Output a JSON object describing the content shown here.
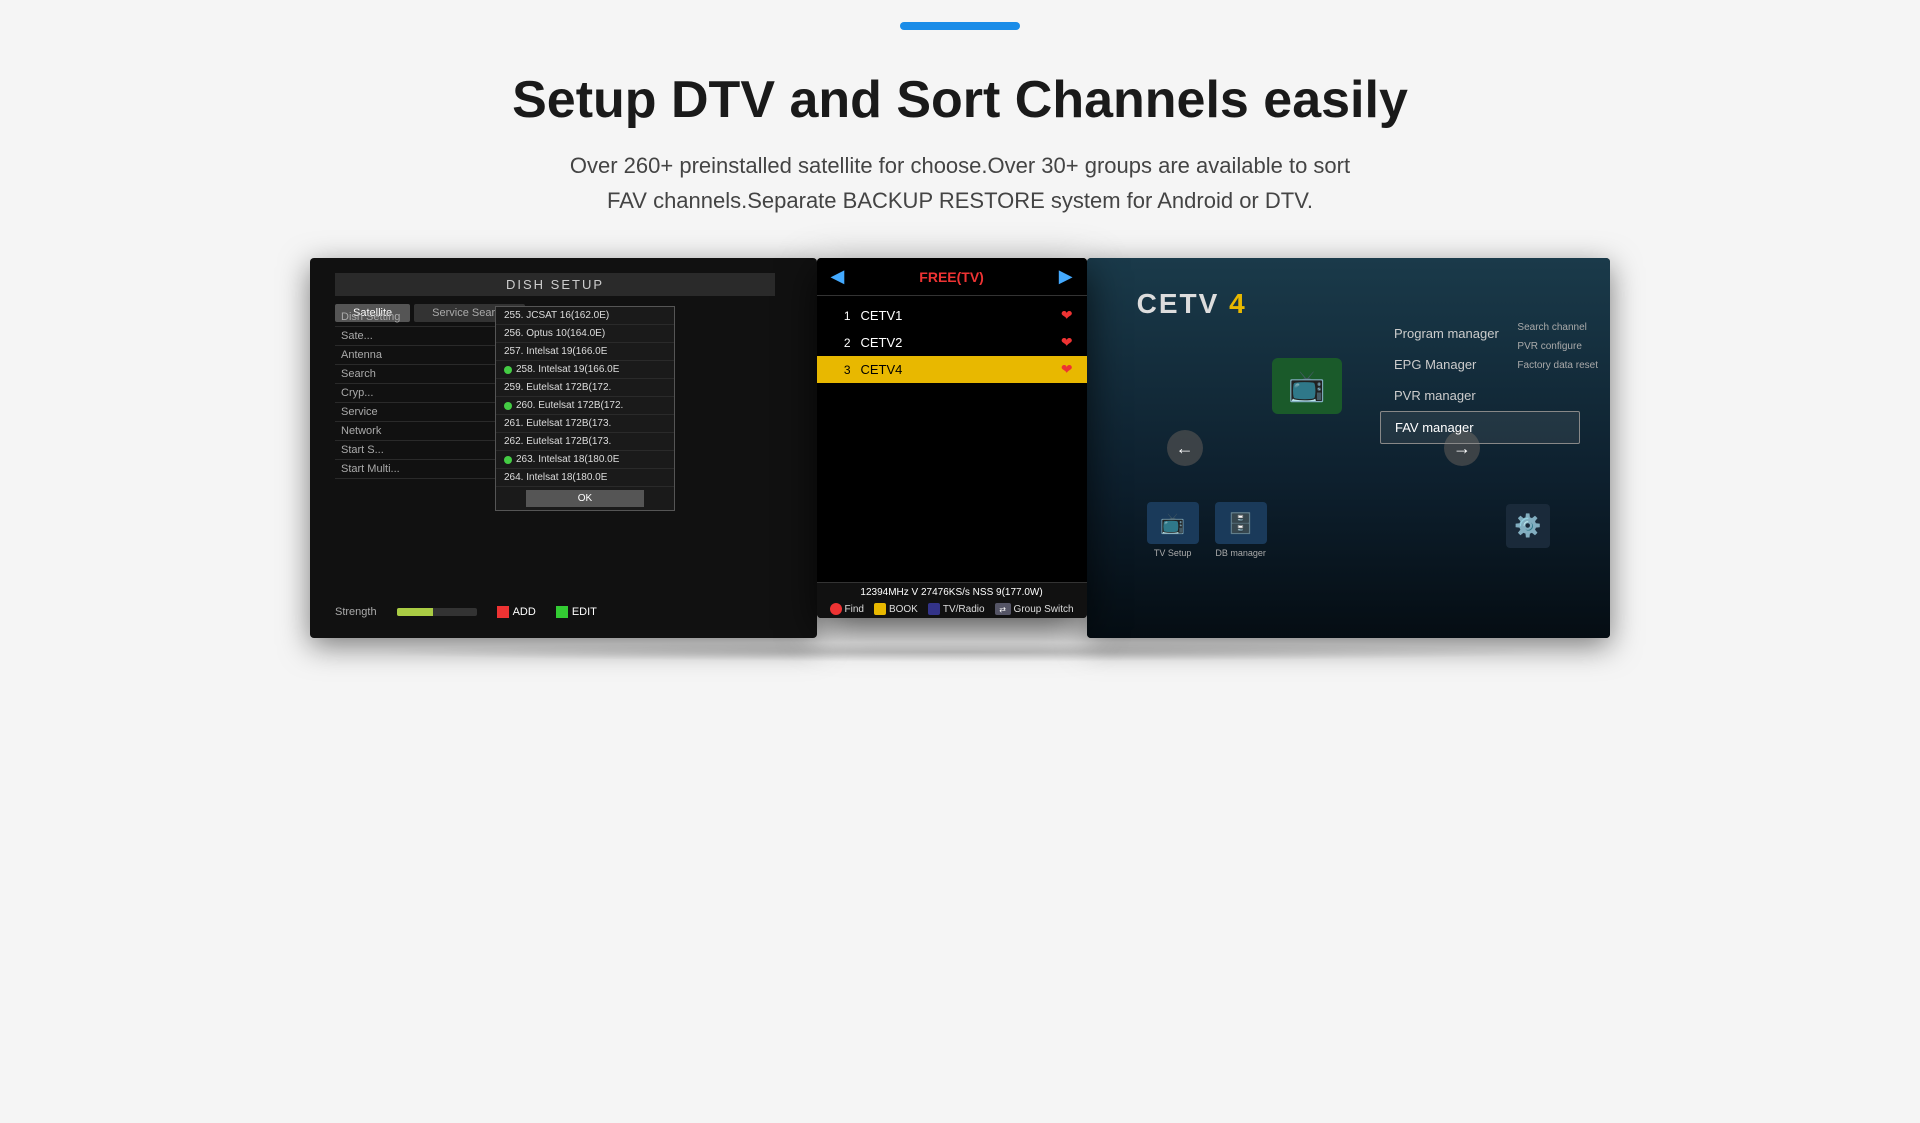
{
  "topbar": {
    "color": "#1a8ce8"
  },
  "header": {
    "title": "Setup DTV and Sort Channels easily",
    "subtitle_line1": "Over 260+ preinstalled satellite for choose.Over 30+ groups are available to sort",
    "subtitle_line2": "FAV channels.Separate BACKUP RESTORE system for Android or DTV."
  },
  "dish_setup": {
    "title": "DISH SETUP",
    "tab1": "Satellite",
    "tab2": "Service Search",
    "settings": [
      {
        "label": "Dish Setting",
        "value": ""
      },
      {
        "label": "Sate...",
        "value": ""
      },
      {
        "label": "Antenna",
        "value": ""
      },
      {
        "label": "Search",
        "value": ""
      },
      {
        "label": "Cryp...",
        "value": ""
      },
      {
        "label": "Service",
        "value": ""
      },
      {
        "label": "Network",
        "value": ""
      },
      {
        "label": "Start S...",
        "value": ""
      },
      {
        "label": "Start Multi...",
        "value": ""
      }
    ],
    "satellites": [
      {
        "num": "255.",
        "name": "JCSAT 16(162.0E)",
        "check": false
      },
      {
        "num": "256.",
        "name": "Optus 10(164.0E)",
        "check": false
      },
      {
        "num": "257.",
        "name": "Intelsat 19(166.0E",
        "check": false
      },
      {
        "num": "258.",
        "name": "Intelsat 19(166.0E",
        "check": true
      },
      {
        "num": "259.",
        "name": "Eutelsat 172B(172.",
        "check": false
      },
      {
        "num": "260.",
        "name": "Eutelsat 172B(172.",
        "check": true
      },
      {
        "num": "261.",
        "name": "Eutelsat 172B(173.",
        "check": false
      },
      {
        "num": "262.",
        "name": "Eutelsat 172B(173.",
        "check": false
      },
      {
        "num": "263.",
        "name": "Intelsat 18(180.0E",
        "check": true
      },
      {
        "num": "264.",
        "name": "Intelsat 18(180.0E",
        "check": false
      }
    ],
    "ok_btn": "OK",
    "add_btn": "ADD",
    "edit_btn": "EDIT",
    "strength_label": "Strength"
  },
  "freetv": {
    "title": "FREE(TV)",
    "channels": [
      {
        "num": 1,
        "name": "CETV1",
        "heart": true,
        "selected": false
      },
      {
        "num": 2,
        "name": "CETV2",
        "heart": true,
        "selected": false
      },
      {
        "num": 3,
        "name": "CETV4",
        "heart": true,
        "selected": true
      }
    ],
    "frequency": "12394MHz  V  27476KS/s  NSS 9(177.0W)",
    "controls": [
      {
        "btn": "red",
        "label": "Find"
      },
      {
        "btn": "yellow",
        "label": "BOOK"
      },
      {
        "btn": "rev",
        "label": "TV/Radio"
      },
      {
        "btn": "double",
        "label": "Group Switch"
      }
    ]
  },
  "program_manager": {
    "logo": "CETV 4",
    "tv_setup_label": "TV Setup",
    "db_manager_label": "DB manager",
    "menu_items": [
      {
        "label": "Program manager",
        "selected": false
      },
      {
        "label": "EPG Manager",
        "selected": false
      },
      {
        "label": "PVR manager",
        "selected": false
      },
      {
        "label": "FAV manager",
        "selected": true
      }
    ],
    "sub_items": [
      {
        "label": "Search channel"
      },
      {
        "label": "PVR configure"
      },
      {
        "label": "Factory data reset"
      }
    ]
  }
}
